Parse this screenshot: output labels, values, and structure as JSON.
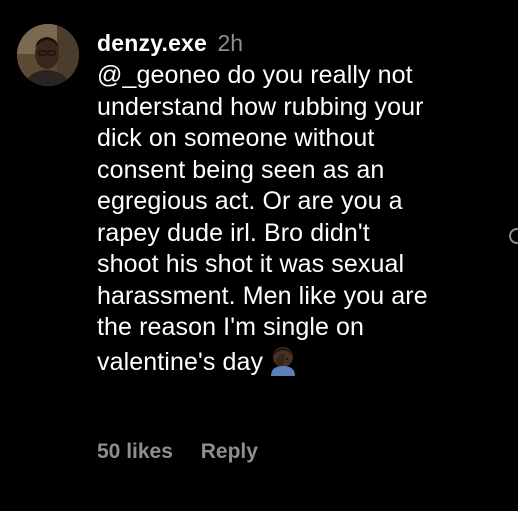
{
  "comment": {
    "username": "denzy.exe",
    "timestamp": "2h",
    "text_lines": [
      "@_geoneo do you really not",
      "understand how rubbing your",
      "dick on someone without",
      "consent being seen as an",
      "egregious act. Or are you a",
      "rapey dude irl. Bro didn't",
      "shoot his shot it was sexual",
      "harassment. Men like you are",
      "the reason I'm single on",
      "valentine's day"
    ],
    "emoji": "facepalm-emoji"
  },
  "footer": {
    "likes": "50 likes",
    "reply": "Reply"
  },
  "colors": {
    "background": "#000000",
    "text": "#ffffff",
    "secondary": "#8e8e8e"
  }
}
